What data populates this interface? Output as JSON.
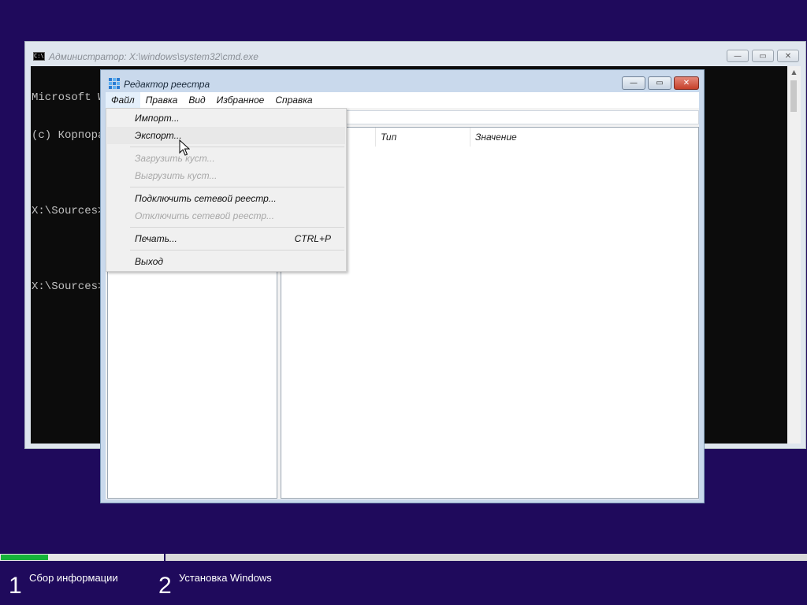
{
  "cmd": {
    "title": "Администратор: X:\\windows\\system32\\cmd.exe",
    "icon_text": "C:\\",
    "buttons": {
      "minimize": "—",
      "maximize": "▭",
      "close": "✕"
    },
    "lines": [
      "Microsoft W",
      "(c) Корпора",
      "",
      "X:\\Sources>",
      "",
      "X:\\Sources>"
    ]
  },
  "regedit": {
    "title": "Редактор реестра",
    "buttons": {
      "minimize": "—",
      "maximize": "▭",
      "close": "✕"
    },
    "menu": [
      "Файл",
      "Правка",
      "Вид",
      "Избранное",
      "Справка"
    ],
    "columns": {
      "name": "",
      "type": "Тип",
      "value": "Значение"
    }
  },
  "file_menu": {
    "items": [
      {
        "label": "Импорт...",
        "enabled": true
      },
      {
        "label": "Экспорт...",
        "enabled": true
      },
      {
        "label": "Загрузить куст...",
        "enabled": false
      },
      {
        "label": "Выгрузить куст...",
        "enabled": false
      },
      {
        "label": "Подключить сетевой реестр...",
        "enabled": true
      },
      {
        "label": "Отключить сетевой реестр...",
        "enabled": false
      },
      {
        "label": "Печать...",
        "enabled": true,
        "shortcut": "CTRL+P"
      },
      {
        "label": "Выход",
        "enabled": true
      }
    ]
  },
  "setup": {
    "progress_fraction": 0.29,
    "steps": [
      {
        "number": "1",
        "label": "Сбор информации"
      },
      {
        "number": "2",
        "label": "Установка Windows"
      }
    ]
  },
  "colors": {
    "desktop": "#1f0a5c",
    "progress_fill": "#16b33a"
  }
}
